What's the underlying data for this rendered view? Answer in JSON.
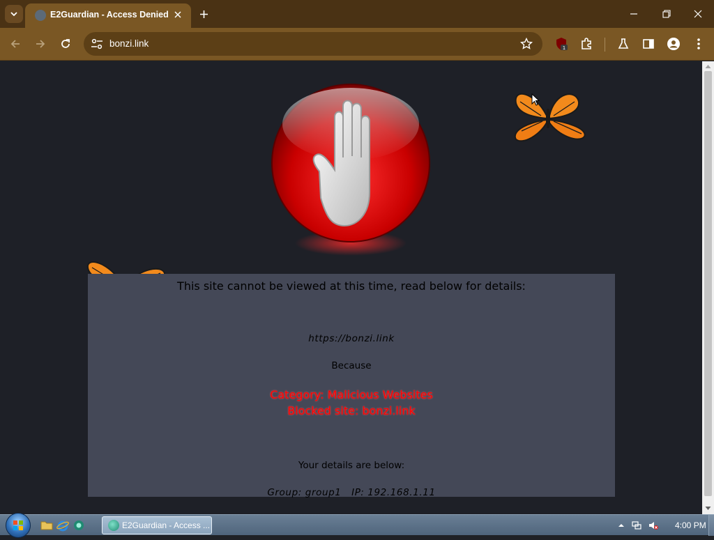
{
  "browser": {
    "tab_title": "E2Guardian - Access Denied",
    "address": "bonzi.link",
    "extension_badge": "1"
  },
  "page": {
    "heading": "This site cannot be viewed at this time, read below for details:",
    "blocked_url": "https://bonzi.link",
    "because_label": "Because",
    "reason_category": "Category: Malicious Websites",
    "reason_site": "Blocked site: bonzi.link",
    "details_heading": "Your details are below:",
    "details_line": "Group: group1   IP: 192.168.1.11"
  },
  "taskbar": {
    "task_label": "E2Guardian - Access ...",
    "clock": "4:00 PM"
  },
  "colors": {
    "titlebar": "#4a3214",
    "toolbar": "#7a5724",
    "page_background": "#1e2027",
    "panel_background": "#444857",
    "reason_text": "#ff0000"
  },
  "icons": [
    "tab-search-icon",
    "close-icon",
    "plus-icon",
    "minimize-icon",
    "restore-icon",
    "back-arrow-icon",
    "forward-arrow-icon",
    "reload-icon",
    "site-settings-icon",
    "star-icon",
    "extension-shield-icon",
    "puzzle-icon",
    "flask-icon",
    "side-panel-icon",
    "profile-icon",
    "more-vert-icon",
    "stop-hand-icon",
    "butterfly-icon"
  ]
}
